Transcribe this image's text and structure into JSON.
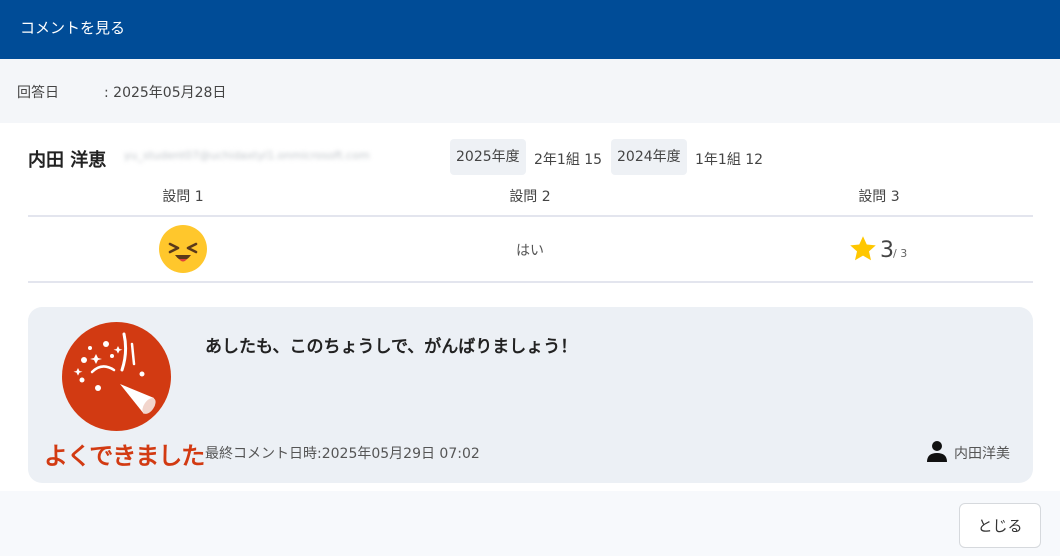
{
  "header": {
    "title": "コメントを見る"
  },
  "answer_date": {
    "label": "回答日",
    "value": ": 2025年05月28日"
  },
  "student": {
    "name": "内田 洋恵",
    "email": "yu_student07@uchidaxtyl1.onmicrosoft.com",
    "enrollments": [
      {
        "year": "2025年度",
        "class": "2年1組 15"
      },
      {
        "year": "2024年度",
        "class": "1年1組 12"
      }
    ]
  },
  "questions": {
    "headers": [
      "設問 1",
      "設問 2",
      "設問 3"
    ],
    "answers": {
      "q1_icon": "laughing-face-icon",
      "q2_text": "はい",
      "q3_score": "3",
      "q3_total": "/ 3"
    }
  },
  "comment": {
    "stamp_icon": "party-popper-icon",
    "stamp_text": "よくできました",
    "text": "あしたも、このちょうしで、がんばりましょう！",
    "last_comment": "最終コメント日時:2025年05月29日 07:02",
    "commenter": "内田洋美"
  },
  "footer": {
    "close_label": "とじる"
  },
  "colors": {
    "header_bg": "#004c97",
    "stamp_red": "#d23a12",
    "star": "#ffc700",
    "emoji": "#ffc72c"
  }
}
